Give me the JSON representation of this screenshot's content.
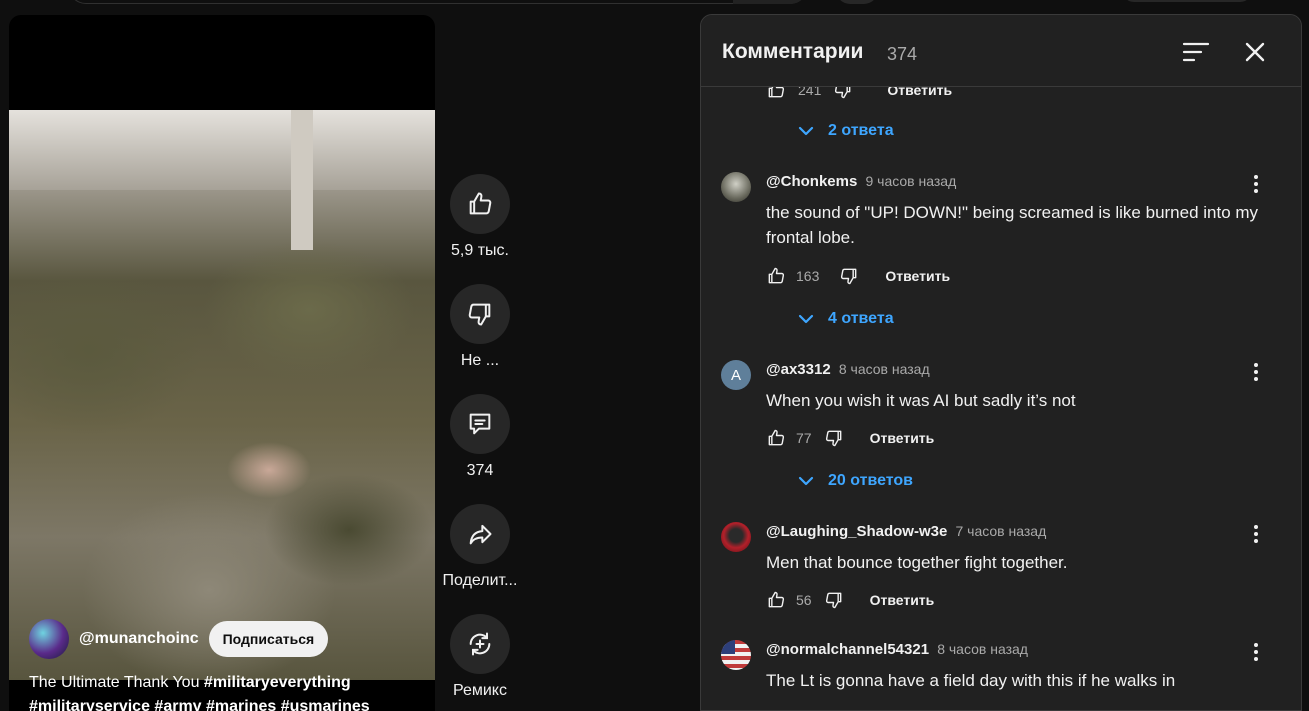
{
  "video": {
    "channel": "@munanchoinc",
    "subscribe_label": "Подписаться",
    "title_plain": "The Ultimate Thank You ",
    "title_tags_line1": "#militaryeverything",
    "title_tags_line2": "#militaryservice #army #marines #usmarines"
  },
  "actions": {
    "like_count": "5,9 тыс.",
    "dislike_label": "Не ...",
    "comments_count": "374",
    "share_label": "Поделит...",
    "remix_label": "Ремикс"
  },
  "comments_panel": {
    "title": "Комментарии",
    "count": "374",
    "truncated_likes": "241",
    "truncated_reply_label": "Ответить",
    "first_replies_label": "2 ответа",
    "comments": [
      {
        "author": "@Chonkems",
        "time": "9 часов назад",
        "text": "the sound of \"UP! DOWN!\" being screamed is like burned into my frontal lobe.",
        "likes": "163",
        "reply_label": "Ответить",
        "replies_label": "4 ответа",
        "avatar_color": "#8a8a7a"
      },
      {
        "author": "@ax3312",
        "time": "8 часов назад",
        "text": "When you wish it was AI but sadly it’s not",
        "likes": "77",
        "reply_label": "Ответить",
        "replies_label": "20 ответов",
        "avatar_letter": "A",
        "avatar_color": "#5f7f9a"
      },
      {
        "author": "@Laughing_Shadow-w3e",
        "time": "7 часов назад",
        "text": "Men that bounce together fight together.",
        "likes": "56",
        "reply_label": "Ответить",
        "avatar_color": "#b2202a"
      },
      {
        "author": "@normalchannel54321",
        "time": "8 часов назад",
        "text": "The Lt is gonna have a field day with this if he walks in",
        "avatar_color": "#c03a3a"
      }
    ]
  },
  "colors": {
    "background": "#0f0f0f",
    "panel": "#212121",
    "link_blue": "#3ea6ff",
    "button_dark": "#272727"
  }
}
